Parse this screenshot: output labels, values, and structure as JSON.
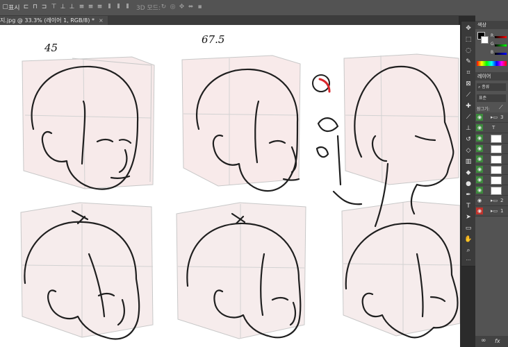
{
  "options_bar": {
    "show_label": "표시",
    "mode_3d_label": "3D 모드:"
  },
  "tab": {
    "title": "지.jpg @ 33.3% (레이어 1, RGB/8) *",
    "close": "×"
  },
  "canvas": {
    "annotations": [
      "45",
      "67.5"
    ]
  },
  "panel": {
    "color_header": "색상",
    "channels": [
      "R",
      "G",
      "B"
    ],
    "layers_header": "레이어",
    "filter_label": "종류",
    "blend_mode": "표준",
    "lock_label": "잠그기:",
    "layers": [
      {
        "name": "3",
        "visible": true,
        "group": true
      },
      {
        "name": "",
        "visible": true
      },
      {
        "name": "",
        "visible": true
      },
      {
        "name": "",
        "visible": true
      },
      {
        "name": "",
        "visible": true
      },
      {
        "name": "",
        "visible": true
      },
      {
        "name": "",
        "visible": true
      },
      {
        "name": "",
        "visible": true
      },
      {
        "name": "2",
        "visible": true,
        "group": true
      },
      {
        "name": "1",
        "visible": true,
        "group": true
      }
    ],
    "footer_link": "∞",
    "footer_fx": "fx"
  },
  "colors": {
    "eye_on": "#3d8a3d",
    "eye_red": "#c0322b",
    "accent_red": "#d9262b"
  }
}
